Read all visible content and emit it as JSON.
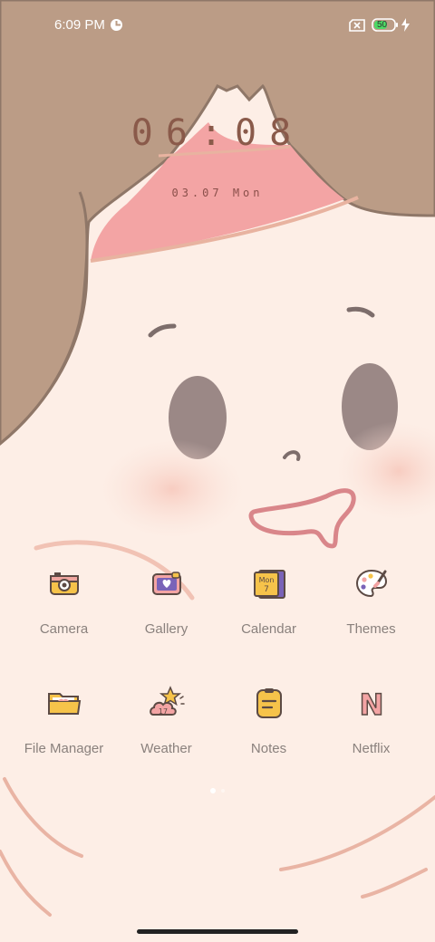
{
  "status_bar": {
    "time": "6:09 PM",
    "battery_level": "50",
    "icons": [
      "data-saver-icon",
      "sim-off-icon",
      "battery-icon",
      "charging-bolt-icon"
    ]
  },
  "lockscreen_clock": {
    "time": "06:08",
    "date": "03.07 Mon"
  },
  "apps": [
    {
      "label": "Camera",
      "icon": "camera-icon"
    },
    {
      "label": "Gallery",
      "icon": "gallery-icon"
    },
    {
      "label": "Calendar",
      "icon": "calendar-icon",
      "icon_text": "Mon",
      "icon_day": "7"
    },
    {
      "label": "Themes",
      "icon": "palette-icon"
    },
    {
      "label": "File Manager",
      "icon": "folder-icon"
    },
    {
      "label": "Weather",
      "icon": "weather-icon",
      "icon_text": "17"
    },
    {
      "label": "Notes",
      "icon": "notes-icon"
    },
    {
      "label": "Netflix",
      "icon": "netflix-icon",
      "icon_text": "N"
    }
  ],
  "page_indicator": {
    "current": 1,
    "total": 2
  },
  "colors": {
    "hair": "#bb9c86",
    "skin": "#fdeee6",
    "headband": "#f3a4a4",
    "eye": "#9b8886",
    "mouth": "#d9868a",
    "label_text": "#8a817d"
  }
}
